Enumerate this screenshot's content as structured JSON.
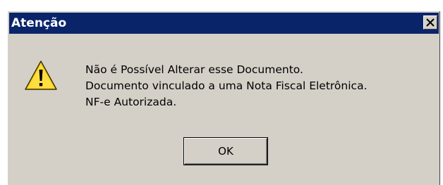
{
  "dialog": {
    "title": "Atenção",
    "close_icon": "close-x",
    "warning_icon": "warning-triangle",
    "message_lines": [
      "Não é Possível Alterar esse Documento.",
      "Documento vinculado a uma Nota Fiscal Eletrônica.",
      "NF-e Autorizada."
    ],
    "ok_label": "OK"
  },
  "colors": {
    "titlebar": "#0a246a",
    "dialog_face": "#d4d0c8",
    "warning_fill": "#ffd21e"
  }
}
